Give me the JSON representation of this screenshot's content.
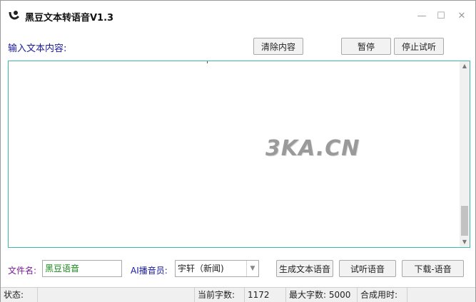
{
  "window": {
    "title": "黑豆文本转语音V1.3",
    "minimize": "—",
    "maximize": "☐",
    "close": "✕"
  },
  "input": {
    "label": "输入文本内容:",
    "value": ""
  },
  "buttons": {
    "clear": "清除内容",
    "pause": "暂停",
    "stop_preview": "停止试听",
    "generate": "生成文本语音",
    "preview": "试听语音",
    "download": "下载-语音"
  },
  "watermark": "3KA.CN",
  "filename": {
    "label": "文件名:",
    "value": "黑豆语音"
  },
  "voice": {
    "label": "AI播音员:",
    "selected": "宇轩（新闻)"
  },
  "status": {
    "state_label": "状态:",
    "state_value": "",
    "chars_label": "当前字数:",
    "chars_value": "1172",
    "max_label": "最大字数:",
    "max_value": "5000",
    "synth_label": "合成用时:",
    "synth_value": ""
  },
  "colors": {
    "accent_label": "#1a1a9a",
    "filename_label": "#7a1a9a",
    "filename_value": "#1a8a1a",
    "textarea_border": "#3fb8a8"
  }
}
